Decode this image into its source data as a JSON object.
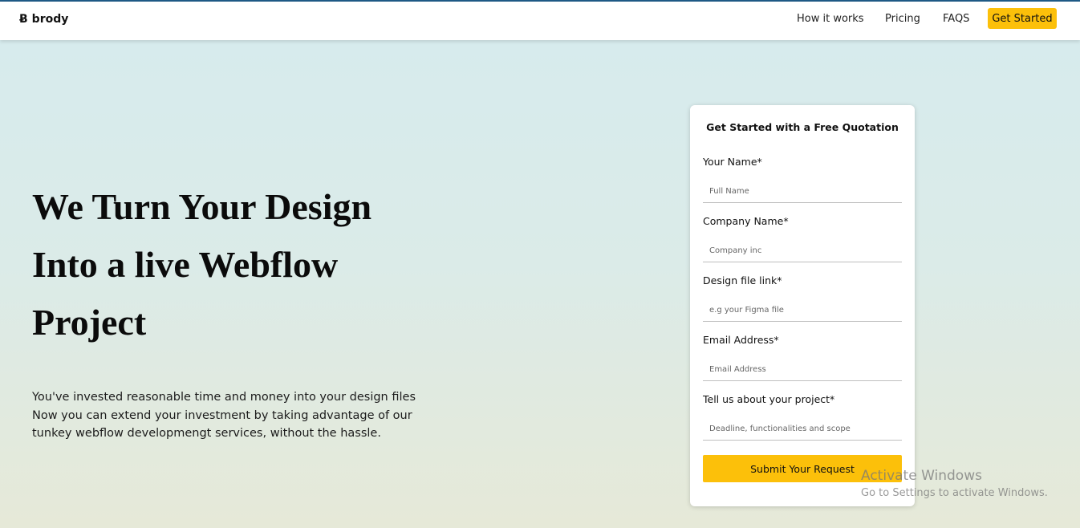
{
  "navbar": {
    "logo_icon": "Ƀ",
    "logo_text": "brody",
    "links": [
      "How it works",
      "Pricing",
      "FAQS"
    ],
    "cta_label": "Get Started"
  },
  "hero": {
    "title_lines": [
      "We Turn Your Design",
      "Into a live Webflow",
      "Project"
    ],
    "description_lines": [
      "You've invested reasonable time and money into your design files",
      "Now you can extend your investment by taking advantage of our",
      "tunkey webflow developmengt services, without the hassle."
    ]
  },
  "form": {
    "title": "Get Started with a Free Quotation",
    "fields": [
      {
        "label": "Your Name*",
        "placeholder": "Full Name",
        "value": ""
      },
      {
        "label": "Company Name*",
        "placeholder": "Company inc",
        "value": ""
      },
      {
        "label": "Design file link*",
        "placeholder": "e.g your Figma file",
        "value": ""
      },
      {
        "label": "Email Address*",
        "placeholder": "Email Address",
        "value": ""
      },
      {
        "label": "Tell us about your project*",
        "placeholder": "Deadline, functionalities and scope",
        "value": ""
      }
    ],
    "submit_label": "Submit Your Request"
  },
  "watermark": {
    "title": "Activate Windows",
    "subtitle": "Go to Settings to activate Windows."
  },
  "colors": {
    "accent": "#fcc00a",
    "top_border": "#1f5a86",
    "background_top": "#d6ebee",
    "background_bottom": "#e6e9d8"
  }
}
